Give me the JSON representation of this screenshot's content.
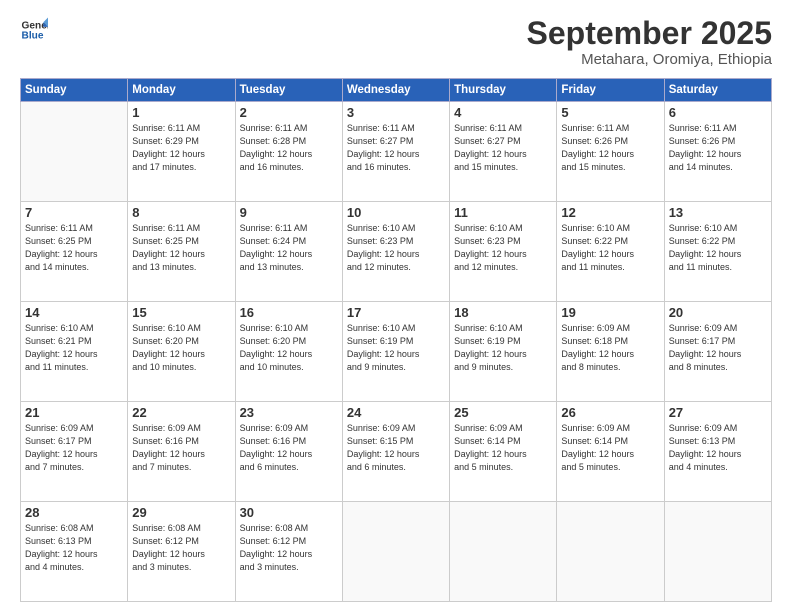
{
  "header": {
    "logo_line1": "General",
    "logo_line2": "Blue",
    "month": "September 2025",
    "location": "Metahara, Oromiya, Ethiopia"
  },
  "weekdays": [
    "Sunday",
    "Monday",
    "Tuesday",
    "Wednesday",
    "Thursday",
    "Friday",
    "Saturday"
  ],
  "weeks": [
    [
      {
        "day": "",
        "info": ""
      },
      {
        "day": "1",
        "info": "Sunrise: 6:11 AM\nSunset: 6:29 PM\nDaylight: 12 hours\nand 17 minutes."
      },
      {
        "day": "2",
        "info": "Sunrise: 6:11 AM\nSunset: 6:28 PM\nDaylight: 12 hours\nand 16 minutes."
      },
      {
        "day": "3",
        "info": "Sunrise: 6:11 AM\nSunset: 6:27 PM\nDaylight: 12 hours\nand 16 minutes."
      },
      {
        "day": "4",
        "info": "Sunrise: 6:11 AM\nSunset: 6:27 PM\nDaylight: 12 hours\nand 15 minutes."
      },
      {
        "day": "5",
        "info": "Sunrise: 6:11 AM\nSunset: 6:26 PM\nDaylight: 12 hours\nand 15 minutes."
      },
      {
        "day": "6",
        "info": "Sunrise: 6:11 AM\nSunset: 6:26 PM\nDaylight: 12 hours\nand 14 minutes."
      }
    ],
    [
      {
        "day": "7",
        "info": "Sunrise: 6:11 AM\nSunset: 6:25 PM\nDaylight: 12 hours\nand 14 minutes."
      },
      {
        "day": "8",
        "info": "Sunrise: 6:11 AM\nSunset: 6:25 PM\nDaylight: 12 hours\nand 13 minutes."
      },
      {
        "day": "9",
        "info": "Sunrise: 6:11 AM\nSunset: 6:24 PM\nDaylight: 12 hours\nand 13 minutes."
      },
      {
        "day": "10",
        "info": "Sunrise: 6:10 AM\nSunset: 6:23 PM\nDaylight: 12 hours\nand 12 minutes."
      },
      {
        "day": "11",
        "info": "Sunrise: 6:10 AM\nSunset: 6:23 PM\nDaylight: 12 hours\nand 12 minutes."
      },
      {
        "day": "12",
        "info": "Sunrise: 6:10 AM\nSunset: 6:22 PM\nDaylight: 12 hours\nand 11 minutes."
      },
      {
        "day": "13",
        "info": "Sunrise: 6:10 AM\nSunset: 6:22 PM\nDaylight: 12 hours\nand 11 minutes."
      }
    ],
    [
      {
        "day": "14",
        "info": "Sunrise: 6:10 AM\nSunset: 6:21 PM\nDaylight: 12 hours\nand 11 minutes."
      },
      {
        "day": "15",
        "info": "Sunrise: 6:10 AM\nSunset: 6:20 PM\nDaylight: 12 hours\nand 10 minutes."
      },
      {
        "day": "16",
        "info": "Sunrise: 6:10 AM\nSunset: 6:20 PM\nDaylight: 12 hours\nand 10 minutes."
      },
      {
        "day": "17",
        "info": "Sunrise: 6:10 AM\nSunset: 6:19 PM\nDaylight: 12 hours\nand 9 minutes."
      },
      {
        "day": "18",
        "info": "Sunrise: 6:10 AM\nSunset: 6:19 PM\nDaylight: 12 hours\nand 9 minutes."
      },
      {
        "day": "19",
        "info": "Sunrise: 6:09 AM\nSunset: 6:18 PM\nDaylight: 12 hours\nand 8 minutes."
      },
      {
        "day": "20",
        "info": "Sunrise: 6:09 AM\nSunset: 6:17 PM\nDaylight: 12 hours\nand 8 minutes."
      }
    ],
    [
      {
        "day": "21",
        "info": "Sunrise: 6:09 AM\nSunset: 6:17 PM\nDaylight: 12 hours\nand 7 minutes."
      },
      {
        "day": "22",
        "info": "Sunrise: 6:09 AM\nSunset: 6:16 PM\nDaylight: 12 hours\nand 7 minutes."
      },
      {
        "day": "23",
        "info": "Sunrise: 6:09 AM\nSunset: 6:16 PM\nDaylight: 12 hours\nand 6 minutes."
      },
      {
        "day": "24",
        "info": "Sunrise: 6:09 AM\nSunset: 6:15 PM\nDaylight: 12 hours\nand 6 minutes."
      },
      {
        "day": "25",
        "info": "Sunrise: 6:09 AM\nSunset: 6:14 PM\nDaylight: 12 hours\nand 5 minutes."
      },
      {
        "day": "26",
        "info": "Sunrise: 6:09 AM\nSunset: 6:14 PM\nDaylight: 12 hours\nand 5 minutes."
      },
      {
        "day": "27",
        "info": "Sunrise: 6:09 AM\nSunset: 6:13 PM\nDaylight: 12 hours\nand 4 minutes."
      }
    ],
    [
      {
        "day": "28",
        "info": "Sunrise: 6:08 AM\nSunset: 6:13 PM\nDaylight: 12 hours\nand 4 minutes."
      },
      {
        "day": "29",
        "info": "Sunrise: 6:08 AM\nSunset: 6:12 PM\nDaylight: 12 hours\nand 3 minutes."
      },
      {
        "day": "30",
        "info": "Sunrise: 6:08 AM\nSunset: 6:12 PM\nDaylight: 12 hours\nand 3 minutes."
      },
      {
        "day": "",
        "info": ""
      },
      {
        "day": "",
        "info": ""
      },
      {
        "day": "",
        "info": ""
      },
      {
        "day": "",
        "info": ""
      }
    ]
  ]
}
